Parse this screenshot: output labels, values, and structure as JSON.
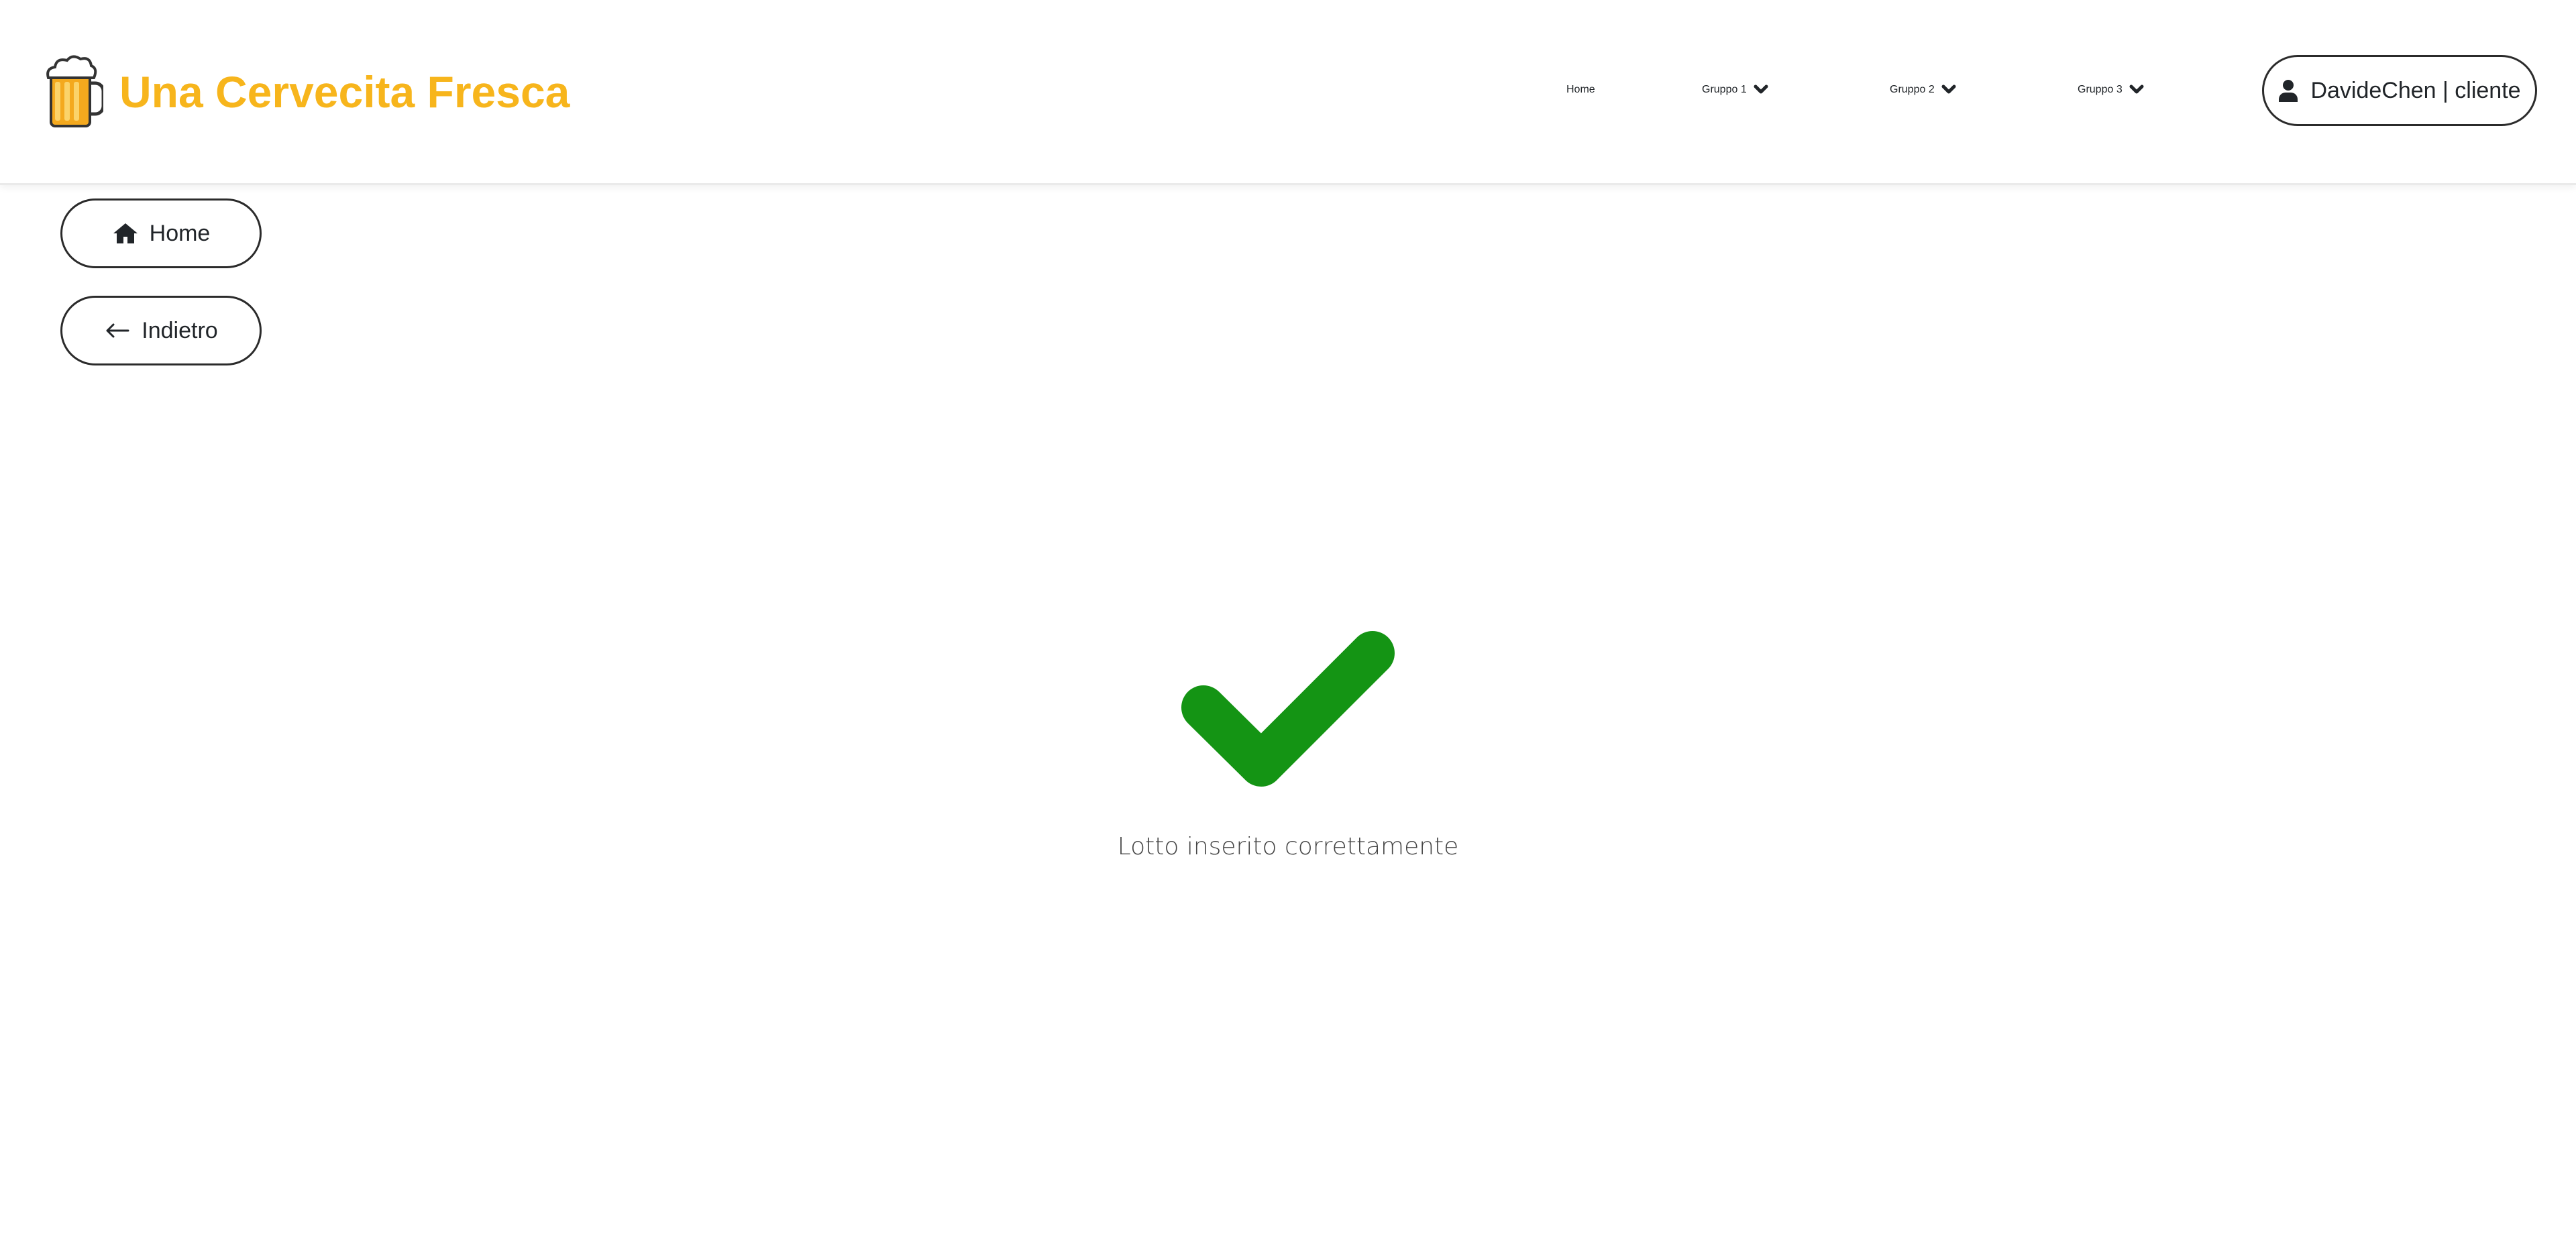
{
  "header": {
    "brand": {
      "name": "Una Cervecita Fresca",
      "logo_icon": "beer-mug-icon",
      "color": "#f7b51c"
    },
    "nav": [
      {
        "label": "Home"
      },
      {
        "label": "Gruppo 1",
        "icon": "chevron-down-icon"
      },
      {
        "label": "Gruppo 2",
        "icon": "chevron-down-icon"
      },
      {
        "label": "Gruppo 3",
        "icon": "chevron-down-icon"
      }
    ],
    "user": {
      "label": "DavideChen | cliente",
      "icon": "user-icon"
    }
  },
  "side_nav": {
    "home": {
      "label": "Home",
      "icon": "home-icon"
    },
    "back": {
      "label": "Indietro",
      "icon": "arrow-left-icon"
    }
  },
  "result": {
    "icon": "checkmark-icon",
    "color": "#149414",
    "message": "Lotto inserito correttamente"
  }
}
